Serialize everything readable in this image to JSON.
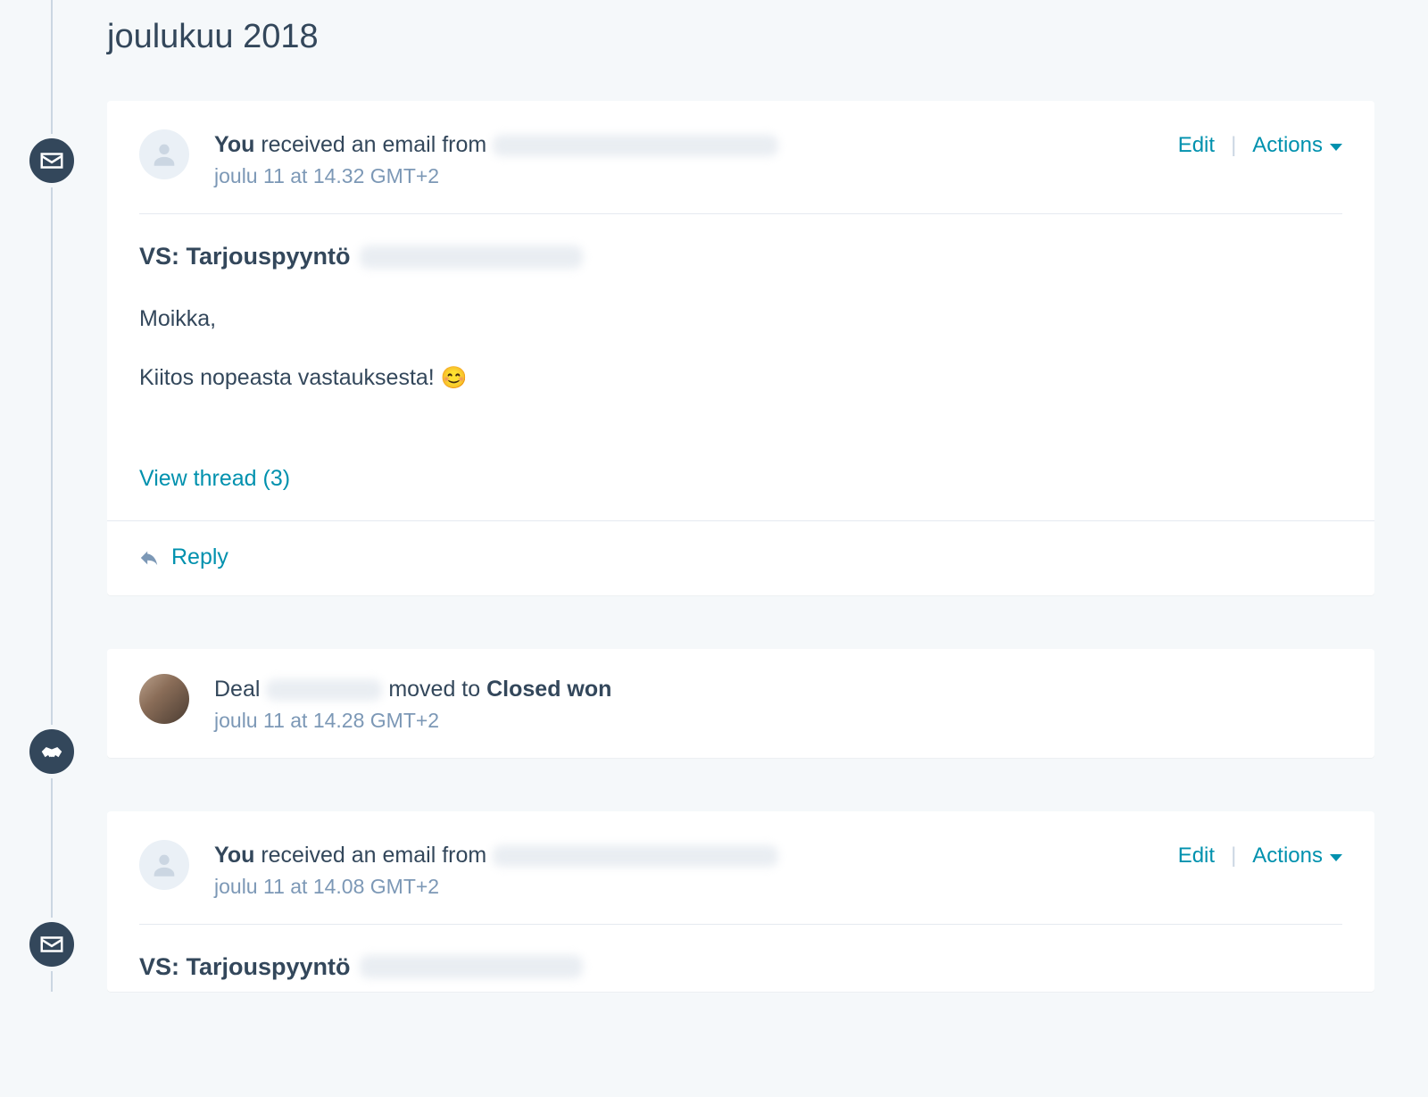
{
  "monthHeader": "joulukuu 2018",
  "items": [
    {
      "type": "email",
      "actor": "You",
      "middleText": " received an email from",
      "timestamp": "joulu 11 at 14.32 GMT+2",
      "editLabel": "Edit",
      "actionsLabel": "Actions",
      "subjectPrefix": "VS: Tarjouspyyntö",
      "bodyGreeting": "Moikka,",
      "bodyLine": "Kiitos nopeasta vastauksesta! ",
      "emoji": "😊",
      "viewThreadLabel": "View thread (3)",
      "replyLabel": "Reply"
    },
    {
      "type": "deal",
      "prefix": "Deal ",
      "middleText": "moved to ",
      "stage": "Closed won",
      "timestamp": "joulu 11 at 14.28 GMT+2"
    },
    {
      "type": "email",
      "actor": "You",
      "middleText": " received an email from",
      "timestamp": "joulu 11 at 14.08 GMT+2",
      "editLabel": "Edit",
      "actionsLabel": "Actions",
      "subjectPrefix": "VS: Tarjouspyyntö"
    }
  ]
}
